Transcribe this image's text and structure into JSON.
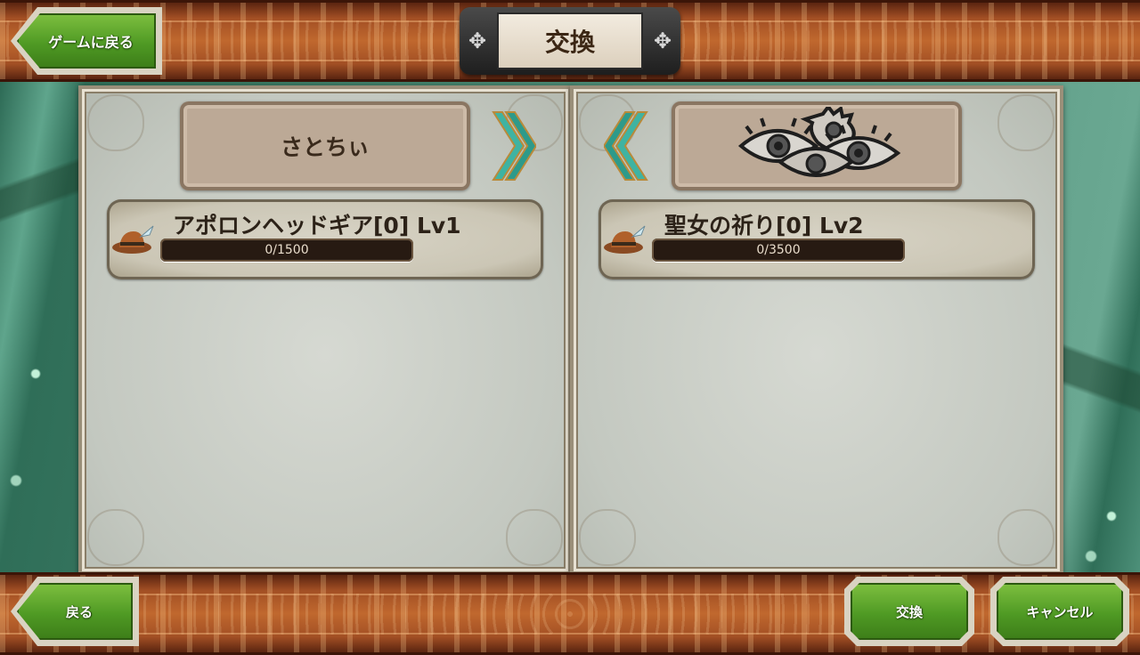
{
  "header": {
    "back_to_game_label": "ゲームに戻る",
    "title": "交換"
  },
  "left_panel": {
    "player_name": "さとちぃ",
    "item": {
      "name": "アポロンヘッドギア[0] Lv1",
      "progress_text": "0/1500",
      "progress_fraction": 0,
      "icon": "feather-hat-icon"
    }
  },
  "right_panel": {
    "player_name": "",
    "waiting_icon": "eyes-icon",
    "item": {
      "name": "聖女の祈り[0] Lv2",
      "progress_text": "0/3500",
      "progress_fraction": 0,
      "icon": "feather-hat-icon"
    }
  },
  "footer": {
    "back_label": "戻る",
    "exchange_label": "交換",
    "cancel_label": "キャンセル"
  },
  "colors": {
    "button_green": "#4f9a24",
    "bar_brown": "#a24f24",
    "panel_bg": "#c3c8c0",
    "arrow_teal": "#3fb3a2"
  }
}
